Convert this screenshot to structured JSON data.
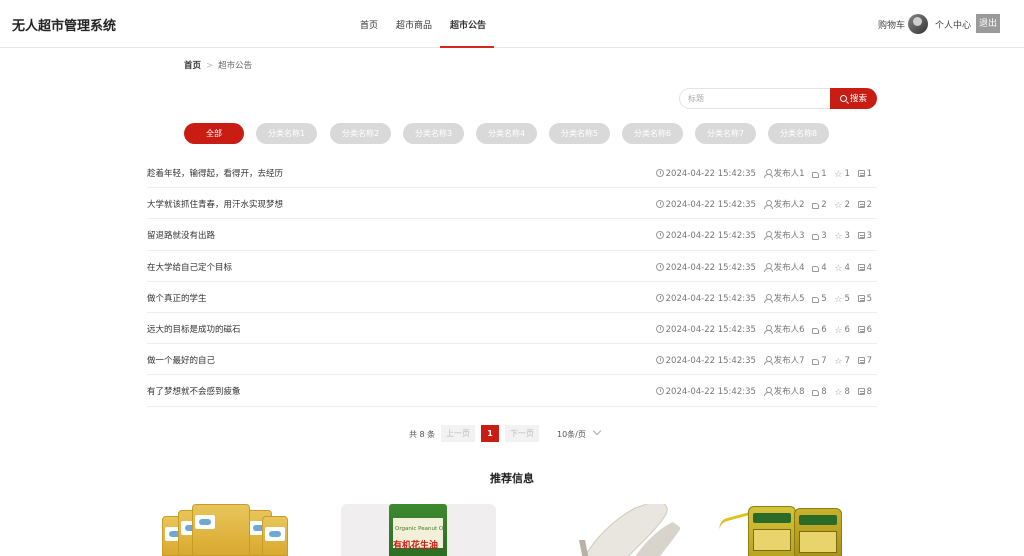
{
  "header": {
    "app_title": "无人超市管理系统",
    "nav": [
      "首页",
      "超市商品",
      "超市公告"
    ],
    "active_nav": "超市公告",
    "cart_label": "购物车",
    "profile_label": "个人中心",
    "logout_label": "退出"
  },
  "breadcrumb": {
    "home": "首页",
    "separator": ">",
    "current": "超市公告"
  },
  "search": {
    "placeholder": "标题",
    "button_label": "搜索"
  },
  "categories": [
    "全部",
    "分类名称1",
    "分类名称2",
    "分类名称3",
    "分类名称4",
    "分类名称5",
    "分类名称6",
    "分类名称7",
    "分类名称8"
  ],
  "active_category": "全部",
  "news": [
    {
      "title": "趁着年轻，输得起，看得开，去经历",
      "time": "2024-04-22 15:42:35",
      "author": "发布人1",
      "likes": "1",
      "favorites": "1",
      "comments": "1"
    },
    {
      "title": "大学就该抓住青春，用汗水实现梦想",
      "time": "2024-04-22 15:42:35",
      "author": "发布人2",
      "likes": "2",
      "favorites": "2",
      "comments": "2"
    },
    {
      "title": "留退路就没有出路",
      "time": "2024-04-22 15:42:35",
      "author": "发布人3",
      "likes": "3",
      "favorites": "3",
      "comments": "3"
    },
    {
      "title": "在大学给自己定个目标",
      "time": "2024-04-22 15:42:35",
      "author": "发布人4",
      "likes": "4",
      "favorites": "4",
      "comments": "4"
    },
    {
      "title": "做个真正的学生",
      "time": "2024-04-22 15:42:35",
      "author": "发布人5",
      "likes": "5",
      "favorites": "5",
      "comments": "5"
    },
    {
      "title": "远大的目标是成功的磁石",
      "time": "2024-04-22 15:42:35",
      "author": "发布人6",
      "likes": "6",
      "favorites": "6",
      "comments": "6"
    },
    {
      "title": "做一个最好的自己",
      "time": "2024-04-22 15:42:35",
      "author": "发布人7",
      "likes": "7",
      "favorites": "7",
      "comments": "7"
    },
    {
      "title": "有了梦想就不会感到疲惫",
      "time": "2024-04-22 15:42:35",
      "author": "发布人8",
      "likes": "8",
      "favorites": "8",
      "comments": "8"
    }
  ],
  "pagination": {
    "total_label": "共 8 条",
    "prev_label": "上一页",
    "current_page": "1",
    "next_label": "下一页",
    "page_size_label": "10条/页"
  },
  "recommend": {
    "title": "推荐信息",
    "peanut_oil_en": "Organic Peanut Oil",
    "peanut_oil_cn": "有机花生油"
  },
  "colors": {
    "accent": "#c91c13",
    "pill_inactive": "#d9d9d9"
  }
}
